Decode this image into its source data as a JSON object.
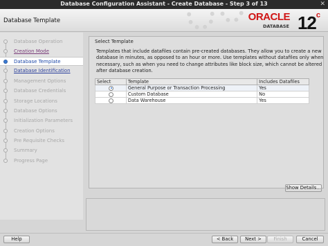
{
  "window": {
    "title": "Database Configuration Assistant - Create Database - Step 3 of 13"
  },
  "banner": {
    "page_title": "Database Template",
    "brand": "ORACLE",
    "product": "DATABASE",
    "version_major": "12",
    "version_suffix": "c"
  },
  "sidebar": {
    "steps": [
      {
        "label": "Database Operation",
        "state": "disabled"
      },
      {
        "label": "Creation Mode",
        "state": "visited"
      },
      {
        "label": "Database Template",
        "state": "current"
      },
      {
        "label": "Database Identification",
        "state": "link"
      },
      {
        "label": "Management Options",
        "state": "disabled"
      },
      {
        "label": "Database Credentials",
        "state": "disabled"
      },
      {
        "label": "Storage Locations",
        "state": "disabled"
      },
      {
        "label": "Database Options",
        "state": "disabled"
      },
      {
        "label": "Initialization Parameters",
        "state": "disabled"
      },
      {
        "label": "Creation Options",
        "state": "disabled"
      },
      {
        "label": "Pre Requisite Checks",
        "state": "disabled"
      },
      {
        "label": "Summary",
        "state": "disabled"
      },
      {
        "label": "Progress Page",
        "state": "disabled"
      }
    ]
  },
  "main": {
    "group_title": "Select Template",
    "description": "Templates that include datafiles contain pre-created databases. They allow you to create a new database in minutes, as opposed to an hour or more. Use templates without datafiles only when necessary, such as when you need to change attributes like block size, which cannot be altered after database creation.",
    "table": {
      "headers": [
        "Select",
        "Template",
        "Includes Datafiles"
      ],
      "rows": [
        {
          "template": "General Purpose or Transaction Processing",
          "datafiles": "Yes",
          "selected": true
        },
        {
          "template": "Custom Database",
          "datafiles": "No",
          "selected": false
        },
        {
          "template": "Data Warehouse",
          "datafiles": "Yes",
          "selected": false
        }
      ]
    },
    "show_details_label": "Show Details..."
  },
  "footer": {
    "help": "Help",
    "back": "< Back",
    "next": "Next >",
    "finish": "Finish",
    "cancel": "Cancel"
  },
  "colors": {
    "brand_red": "#d01515",
    "current_step_blue": "#1c47a8"
  }
}
